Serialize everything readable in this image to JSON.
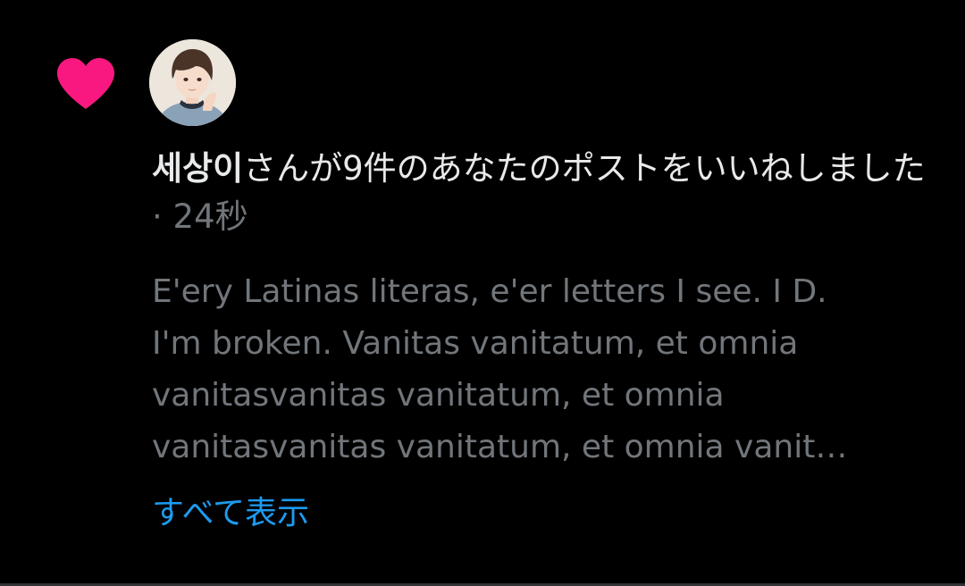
{
  "notification": {
    "icon": "heart-icon",
    "icon_color": "#f91880",
    "username": "세상이",
    "action_text": "さんが9件のあなたのポストをいいねしました",
    "separator": " · ",
    "time": "24秒",
    "post_lines": [
      "E'ery Latinas literas, e'er letters I see. I D.",
      "I'm broken. Vanitas vanitatum, et omnia",
      "vanitasvanitas vanitatum, et omnia",
      "vanitasvanitas vanitatum, et omnia vanit…"
    ],
    "show_all_label": "すべて表示",
    "link_color": "#1d9bf0"
  }
}
